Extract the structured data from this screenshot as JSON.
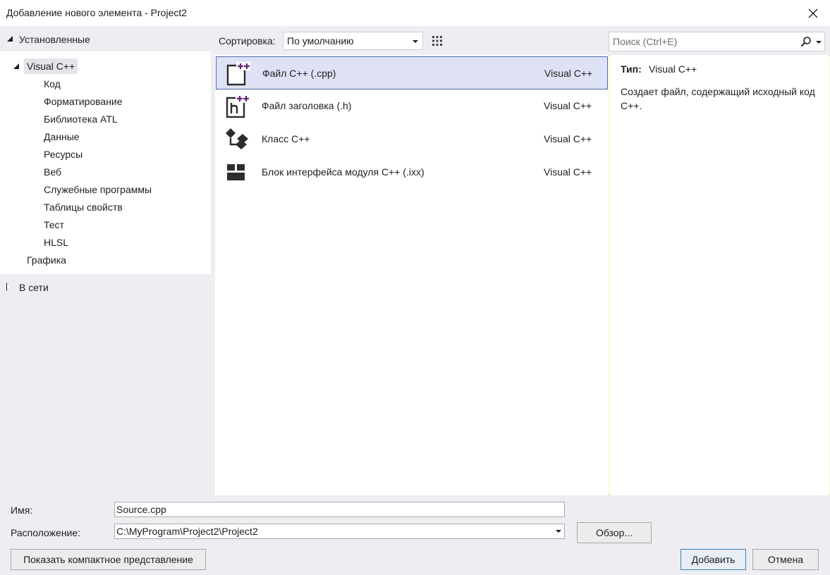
{
  "window": {
    "title": "Добавление нового элемента  - Project2"
  },
  "tree": {
    "installed_label": "Установленные",
    "root_label": "Visual C++",
    "children": [
      "Код",
      "Форматирование",
      "Библиотека ATL",
      "Данные",
      "Ресурсы",
      "Веб",
      "Служебные программы",
      "Таблицы свойств",
      "Тест",
      "HLSL"
    ],
    "graphics_label": "Графика",
    "online_label": "В сети"
  },
  "toolbar": {
    "sort_label": "Сортировка:",
    "sort_value": "По умолчанию",
    "search_placeholder": "Поиск (Ctrl+E)"
  },
  "templates": [
    {
      "name": "Файл C++ (.cpp)",
      "lang": "Visual C++",
      "icon": "cpp-file-icon",
      "selected": true
    },
    {
      "name": "Файл заголовка (.h)",
      "lang": "Visual C++",
      "icon": "header-file-icon",
      "selected": false
    },
    {
      "name": "Класс C++",
      "lang": "Visual C++",
      "icon": "class-icon",
      "selected": false
    },
    {
      "name": "Блок интерфейса модуля C++ (.ixx)",
      "lang": "Visual C++",
      "icon": "module-icon",
      "selected": false
    }
  ],
  "description": {
    "type_label": "Тип:",
    "type_value": "Visual C++",
    "text": "Создает файл, содержащий исходный код C++."
  },
  "form": {
    "name_label": "Имя:",
    "name_value": "Source.cpp",
    "location_label": "Расположение:",
    "location_value": "C:\\MyProgram\\Project2\\Project2",
    "browse_label": "Обзор...",
    "compact_label": "Показать компактное представление",
    "add_label": "Добавить",
    "cancel_label": "Отмена"
  },
  "colors": {
    "accent": "#68217a",
    "selection_border": "#4a6aa8",
    "selection_fill": "#dfe1f5"
  }
}
